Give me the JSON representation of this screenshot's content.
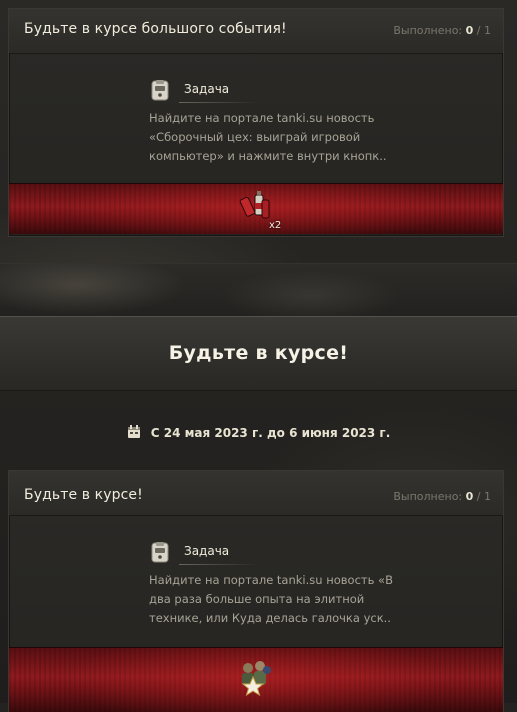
{
  "missions": [
    {
      "title": "Будьте в курсе большого события!",
      "progress_label": "Выполнено:",
      "progress_done": "0",
      "progress_total": "1",
      "task_label": "Задача",
      "task_description": "Найдите на портале tanki.su новость «Сборочный цех: выиграй игровой компьютер» и нажмите внутри кнопк..",
      "reward_icon": "consumables-icon",
      "reward_count": "x2"
    },
    {
      "title": "Будьте в курсе!",
      "progress_label": "Выполнено:",
      "progress_done": "0",
      "progress_total": "1",
      "task_label": "Задача",
      "task_description": "Найдите на портале tanki.su новость «В два раза больше опыта на элитной технике, или Куда делась галочка уск..",
      "reward_icon": "crew-star-icon"
    }
  ],
  "event": {
    "title": "Будьте в курсе!",
    "date_range": "С 24 мая 2023 г. до 6 июня 2023 г."
  },
  "colors": {
    "reward_red": "#8e1a1e",
    "text_light": "#e9e4d2",
    "text_muted": "#a8a396"
  }
}
